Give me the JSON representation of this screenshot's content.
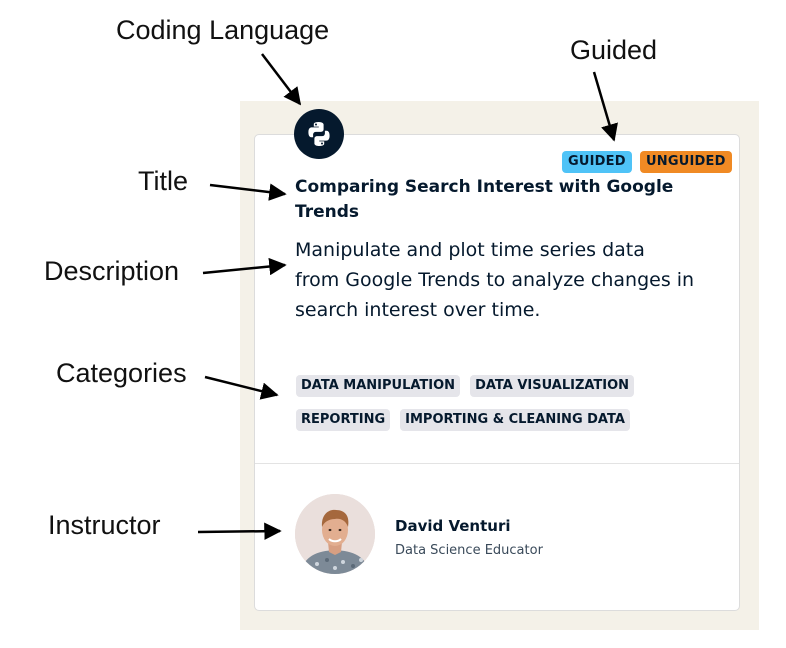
{
  "annotations": {
    "coding_language": "Coding Language",
    "guided": "Guided",
    "title": "Title",
    "description": "Description",
    "categories": "Categories",
    "instructor": "Instructor"
  },
  "card": {
    "language_icon": "python-icon",
    "tags": {
      "guided": "GUIDED",
      "unguided": "UNGUIDED",
      "guided_color": "#4fc3f7",
      "unguided_color": "#f08a24"
    },
    "title": "Comparing Search Interest with Google Trends",
    "description": "Manipulate and plot time series data from Google Trends to analyze changes in search interest over time.",
    "categories": [
      "DATA MANIPULATION",
      "DATA VISUALIZATION",
      "REPORTING",
      "IMPORTING & CLEANING DATA"
    ],
    "instructor": {
      "name": "David Venturi",
      "role": "Data Science Educator",
      "avatar": "instructor-photo"
    }
  },
  "colors": {
    "navy": "#05192d",
    "panel_bg": "#f4f1e8",
    "category_bg": "#e5e5ea"
  }
}
